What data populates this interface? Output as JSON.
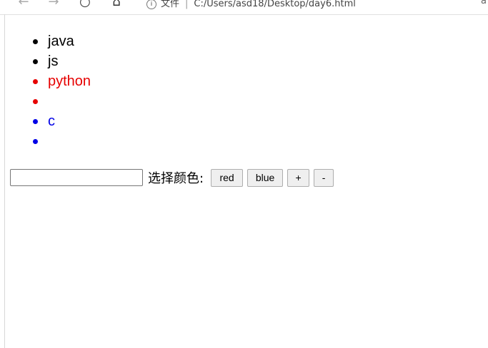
{
  "browser": {
    "address_label": "文件",
    "url": "C:/Users/asd18/Desktop/day6.html",
    "trailing_text": "a"
  },
  "list": {
    "items": [
      {
        "label": "java",
        "color": "#000000"
      },
      {
        "label": "js",
        "color": "#000000"
      },
      {
        "label": "python",
        "color": "#e60000"
      },
      {
        "label": "",
        "color": "#e60000"
      },
      {
        "label": "c",
        "color": "#0000e6"
      },
      {
        "label": "",
        "color": "#0000e6"
      }
    ]
  },
  "controls": {
    "input_value": "",
    "color_label": "选择颜色:",
    "buttons": {
      "red": "red",
      "blue": "blue",
      "plus": "+",
      "minus": "-"
    }
  }
}
